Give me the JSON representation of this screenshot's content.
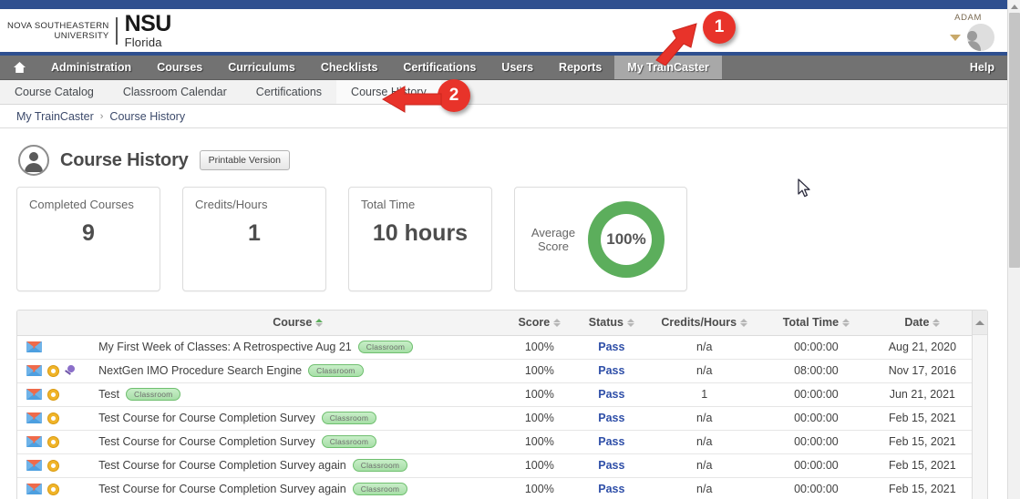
{
  "brand": {
    "line1": "NOVA SOUTHEASTERN",
    "line2": "UNIVERSITY",
    "abbr": "NSU",
    "state": "Florida"
  },
  "user": {
    "name": "ADAM",
    "caret": "chevron-down-icon",
    "avatar": "user-avatar"
  },
  "main_nav": {
    "home_icon": "home-icon",
    "items": [
      "Administration",
      "Courses",
      "Curriculums",
      "Checklists",
      "Certifications",
      "Users",
      "Reports",
      "My TrainCaster"
    ],
    "active": "My TrainCaster",
    "help": "Help"
  },
  "sub_nav": {
    "items": [
      "Course Catalog",
      "Classroom Calendar",
      "Certifications",
      "Course History"
    ],
    "active": "Course History"
  },
  "breadcrumb": {
    "parent": "My TrainCaster",
    "separator": "›",
    "current": "Course History"
  },
  "page": {
    "title": "Course History",
    "printable_button": "Printable Version"
  },
  "cards": [
    {
      "label": "Completed Courses",
      "value": "9"
    },
    {
      "label": "Credits/Hours",
      "value": "1"
    },
    {
      "label": "Total Time",
      "value": "10 hours"
    }
  ],
  "average_score": {
    "label_line1": "Average",
    "label_line2": "Score",
    "value": "100%",
    "ring_color": "#5cae5c"
  },
  "table": {
    "columns": [
      "Course",
      "Score",
      "Status",
      "Credits/Hours",
      "Total Time",
      "Date"
    ],
    "sorted_by": "Course",
    "sort_direction": "asc",
    "rows": [
      {
        "icons": [
          "envelope-icon"
        ],
        "course": "My First Week of Classes: A Retrospective Aug 21",
        "badge": "Classroom",
        "score": "100%",
        "status": "Pass",
        "credits": "n/a",
        "total_time": "00:00:00",
        "date": "Aug 21, 2020"
      },
      {
        "icons": [
          "envelope-icon",
          "star-icon",
          "pushpin-icon"
        ],
        "course": "NextGen IMO Procedure Search Engine",
        "badge": "Classroom",
        "score": "100%",
        "status": "Pass",
        "credits": "n/a",
        "total_time": "08:00:00",
        "date": "Nov 17, 2016"
      },
      {
        "icons": [
          "envelope-icon",
          "star-icon"
        ],
        "course": "Test",
        "badge": "Classroom",
        "score": "100%",
        "status": "Pass",
        "credits": "1",
        "total_time": "00:00:00",
        "date": "Jun 21, 2021"
      },
      {
        "icons": [
          "envelope-icon",
          "star-icon"
        ],
        "course": "Test Course for Course Completion Survey",
        "badge": "Classroom",
        "score": "100%",
        "status": "Pass",
        "credits": "n/a",
        "total_time": "00:00:00",
        "date": "Feb 15, 2021"
      },
      {
        "icons": [
          "envelope-icon",
          "star-icon"
        ],
        "course": "Test Course for Course Completion Survey",
        "badge": "Classroom",
        "score": "100%",
        "status": "Pass",
        "credits": "n/a",
        "total_time": "00:00:00",
        "date": "Feb 15, 2021"
      },
      {
        "icons": [
          "envelope-icon",
          "star-icon"
        ],
        "course": "Test Course for Course Completion Survey again",
        "badge": "Classroom",
        "score": "100%",
        "status": "Pass",
        "credits": "n/a",
        "total_time": "00:00:00",
        "date": "Feb 15, 2021"
      },
      {
        "icons": [
          "envelope-icon",
          "star-icon"
        ],
        "course": "Test Course for Course Completion Survey again",
        "badge": "Classroom",
        "score": "100%",
        "status": "Pass",
        "credits": "n/a",
        "total_time": "00:00:00",
        "date": "Feb 15, 2021"
      }
    ]
  },
  "annotations": [
    {
      "number": "1",
      "points_to": "My TrainCaster"
    },
    {
      "number": "2",
      "points_to": "Course History"
    }
  ],
  "colors": {
    "header_blue": "#2e4f8f",
    "nav_gray": "#727272",
    "nav_active_gray": "#a8a8a8",
    "status_blue": "#2f4fa8",
    "badge_green": "#6fbf6f",
    "annotation_red": "#e8332a"
  }
}
